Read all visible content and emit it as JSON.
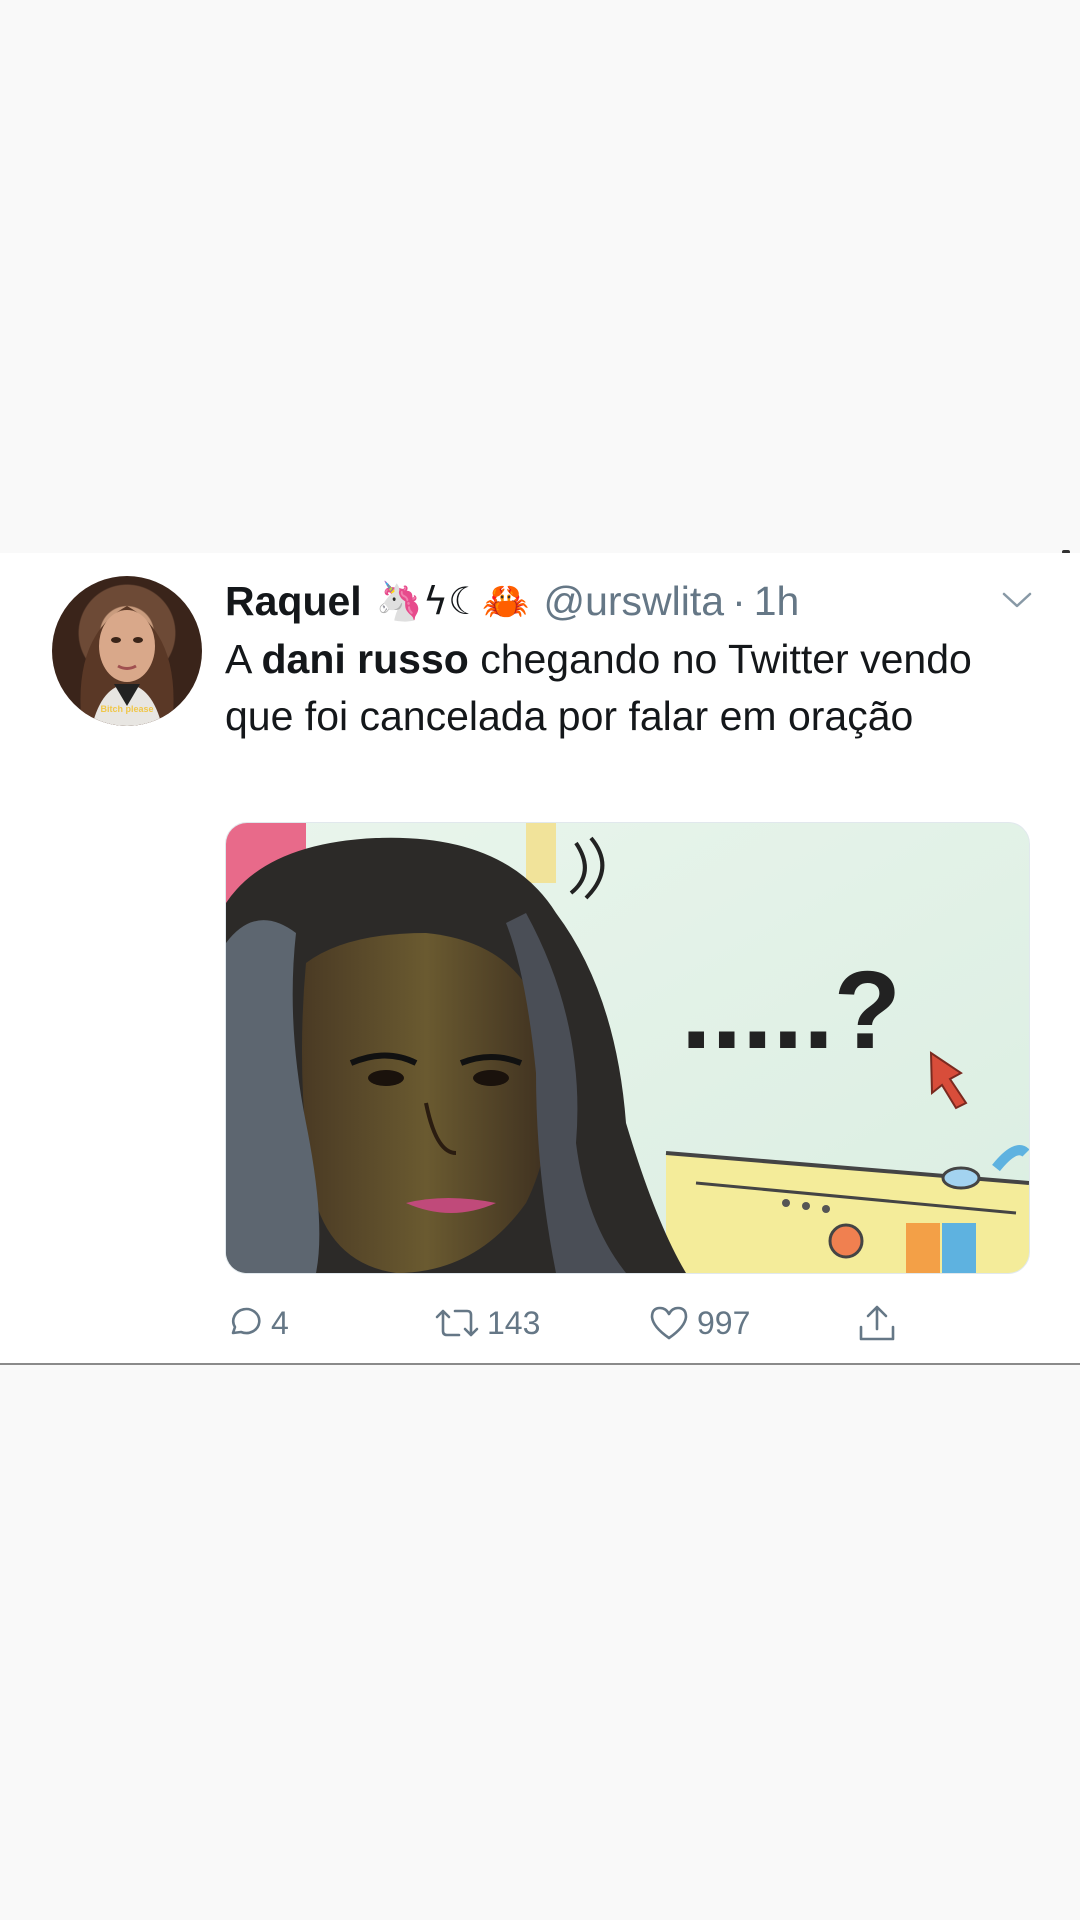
{
  "tweet": {
    "display_name": "Raquel",
    "name_emojis": "🦄ϟ☾🦀",
    "handle": "@urswlita",
    "separator": "·",
    "time": "1h",
    "text_part1": "A ",
    "text_bold": "dani russo",
    "text_part2": " chegando no Twitter vendo que foi cancelada por falar em oração",
    "avatar_caption": "Bitch please",
    "media": {
      "text": ".....?"
    },
    "actions": {
      "replies": "4",
      "retweets": "143",
      "likes": "997"
    }
  },
  "icons": [
    "reply-icon",
    "retweet-icon",
    "like-icon",
    "share-icon",
    "chevron-down-icon"
  ],
  "colors": {
    "secondary_text": "#657786",
    "primary_text": "#14171a",
    "card_bg": "#ffffff",
    "page_bg": "#f9f9f9"
  }
}
